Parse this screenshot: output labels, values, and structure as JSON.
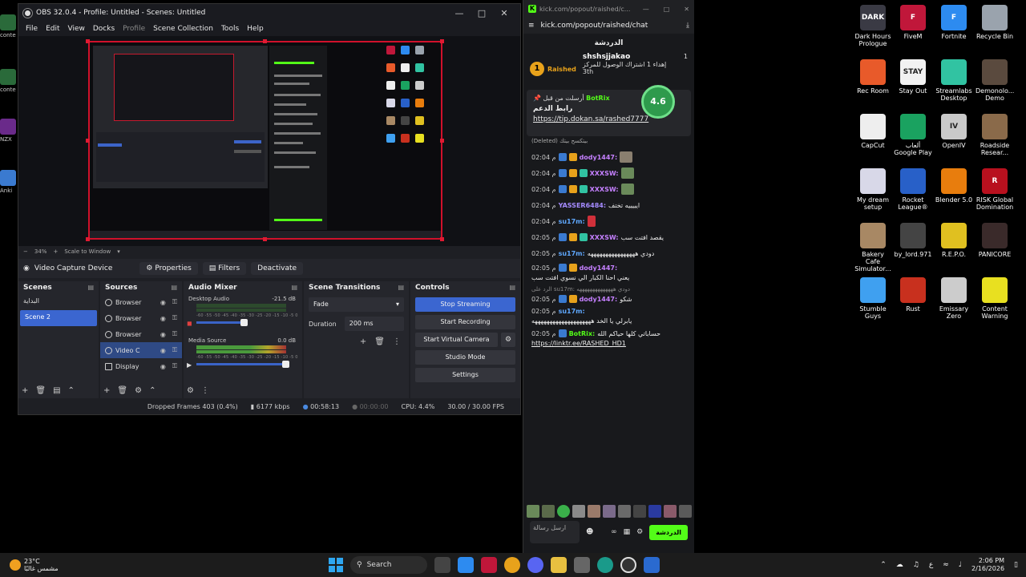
{
  "obs": {
    "title": "OBS 32.0.4 - Profile: Untitled - Scenes: Untitled",
    "menu": [
      "File",
      "Edit",
      "View",
      "Docks",
      "Profile",
      "Scene Collection",
      "Tools",
      "Help"
    ],
    "zoom": "34%",
    "scale_mode": "Scale to Window",
    "source_toolbar": {
      "source_name": "Video Capture Device",
      "properties": "Properties",
      "filters": "Filters",
      "deactivate": "Deactivate"
    },
    "scenes": {
      "title": "Scenes",
      "items": [
        "البداية",
        "Scene 2"
      ],
      "selected": "Scene 2"
    },
    "sources": {
      "title": "Sources",
      "items": [
        {
          "name": "Browser",
          "selected": false
        },
        {
          "name": "Browser",
          "selected": false
        },
        {
          "name": "Browser",
          "selected": false
        },
        {
          "name": "Video C",
          "selected": true
        },
        {
          "name": "Display",
          "selected": false
        }
      ]
    },
    "audio_mixer": {
      "title": "Audio Mixer",
      "channels": [
        {
          "name": "Desktop Audio",
          "level": "-21.5 dB"
        },
        {
          "name": "Media Source",
          "level": "0.0 dB"
        }
      ],
      "ticks": "-60 -55 -50 -45 -40 -35 -30 -25 -20 -15 -10 -5 0"
    },
    "scene_transitions": {
      "title": "Scene Transitions",
      "transition": "Fade",
      "duration_label": "Duration",
      "duration": "200 ms"
    },
    "controls": {
      "title": "Controls",
      "stop_streaming": "Stop Streaming",
      "start_recording": "Start Recording",
      "start_virtual_camera": "Start Virtual Camera",
      "studio_mode": "Studio Mode",
      "settings": "Settings"
    },
    "status": {
      "dropped_frames": "Dropped Frames 403 (0.4%)",
      "bitrate": "6177 kbps",
      "stream_time": "00:58:13",
      "record_time": "00:00:00",
      "cpu": "CPU: 4.4%",
      "fps": "30.00 / 30.00 FPS"
    }
  },
  "kick": {
    "window_title": "kick.com/popout/raished/c...",
    "url": "kick.com/popout/raished/chat",
    "chat_label": "الدردشة",
    "leaderboard": {
      "channel": "Raished",
      "rank": "1",
      "user": "shshsjjakao",
      "count": "1",
      "sub_text": "إهداء 1 اشتراك الوصول للمركز",
      "place": "3th"
    },
    "pinned": {
      "sent_by": "أرسلت من قبل",
      "bot": "BotRix",
      "title": "رابط الدعم",
      "link": "https://tip.dokan.sa/rashed7777",
      "rating": "4.6"
    },
    "deleted_note": "(Deleted) بيتكسح بيتك",
    "messages": [
      {
        "time": "02:04 م",
        "user": "dody1447:",
        "color": "#c580ff",
        "text": ""
      },
      {
        "time": "02:04 م",
        "user": "XXXSW:",
        "color": "#c580ff",
        "text": ""
      },
      {
        "time": "02:04 م",
        "user": "XXXSW:",
        "color": "#c580ff",
        "text": ""
      },
      {
        "time": "02:04 م",
        "user": "YASSER6484:",
        "color": "#a58bff",
        "text": "ايييييه تختف"
      },
      {
        "time": "02:04 م",
        "user": "su17m:",
        "color": "#5fa8ff",
        "text": ""
      },
      {
        "time": "02:05 م",
        "user": "XXXSW:",
        "color": "#c580ff",
        "text": "يقصد افتت سب"
      },
      {
        "time": "02:05 م",
        "user": "su17m:",
        "color": "#5fa8ff",
        "text": "دودي ههههههههههههههههه"
      },
      {
        "time": "02:05 م",
        "user": "dody1447:",
        "color": "#c580ff",
        "text": "يعني احنا الكبار الي نسوي افتت سب"
      },
      {
        "time": "02:05 م",
        "user": "dody1447:",
        "color": "#c580ff",
        "text": "شكو",
        "reply": "الرد على su17m: دودي ههههههههههههههه"
      },
      {
        "time": "02:05 م",
        "user": "su17m:",
        "color": "#5fa8ff",
        "text": "يابرلي يا الخد ههههههههههههههههههههه"
      },
      {
        "time": "02:05 م",
        "user": "BotRix:",
        "color": "#53fc18",
        "text": "حساباتي كلها حياكم الله",
        "link": "https://linktr.ee/RASHED_HD1"
      }
    ],
    "send_label": "الدردشة",
    "input_placeholder": "ارسل رسالة"
  },
  "desktop_icons": [
    {
      "label": "Dark Hours Prologue",
      "color": "#3a3a44",
      "text": "DARK"
    },
    {
      "label": "FiveM",
      "color": "#c0173a",
      "text": "F"
    },
    {
      "label": "Fortnite",
      "color": "#2d8bf0",
      "text": "F"
    },
    {
      "label": "Recycle Bin",
      "color": "#9aa3ad",
      "text": ""
    },
    {
      "label": "Rec Room",
      "color": "#e85a2a",
      "text": ""
    },
    {
      "label": "Stay Out",
      "color": "#f2f2f2",
      "text": "STAY"
    },
    {
      "label": "Streamlabs Desktop",
      "color": "#31c3a2",
      "text": ""
    },
    {
      "label": "Demonolo... Demo",
      "color": "#5a4a3e",
      "text": ""
    },
    {
      "label": "CapCut",
      "color": "#eeeeee",
      "text": ""
    },
    {
      "label": "ألعاب Google Play",
      "color": "#1aa260",
      "text": ""
    },
    {
      "label": "OpenIV",
      "color": "#c9c9c9",
      "text": "IV"
    },
    {
      "label": "Roadside Resear...",
      "color": "#8a6a4a",
      "text": ""
    },
    {
      "label": "My dream setup",
      "color": "#d8d8e8",
      "text": ""
    },
    {
      "label": "Rocket League®",
      "color": "#2860c8",
      "text": ""
    },
    {
      "label": "Blender 5.0",
      "color": "#e87d0d",
      "text": ""
    },
    {
      "label": "RISK Global Domination",
      "color": "#b8101e",
      "text": "R"
    },
    {
      "label": "Bakery Cafe Simulator...",
      "color": "#a88864",
      "text": ""
    },
    {
      "label": "by_lord.971",
      "color": "#444444",
      "text": ""
    },
    {
      "label": "R.E.P.O.",
      "color": "#e0c020",
      "text": ""
    },
    {
      "label": "PANICORE",
      "color": "#3a2a2a",
      "text": ""
    },
    {
      "label": "Stumble Guys",
      "color": "#3fa0f0",
      "text": ""
    },
    {
      "label": "Rust",
      "color": "#c8301e",
      "text": ""
    },
    {
      "label": "Emissary Zero",
      "color": "#cccccc",
      "text": ""
    },
    {
      "label": "Content Warning",
      "color": "#e8e020",
      "text": ""
    }
  ],
  "left_icons": [
    "conte",
    "conte",
    "NZX",
    "Anki"
  ],
  "taskbar": {
    "temp": "23°C",
    "weather": "مشمس غالبًا",
    "search": "Search",
    "lang": "ع",
    "time": "2:06 PM",
    "date": "2/16/2026"
  }
}
